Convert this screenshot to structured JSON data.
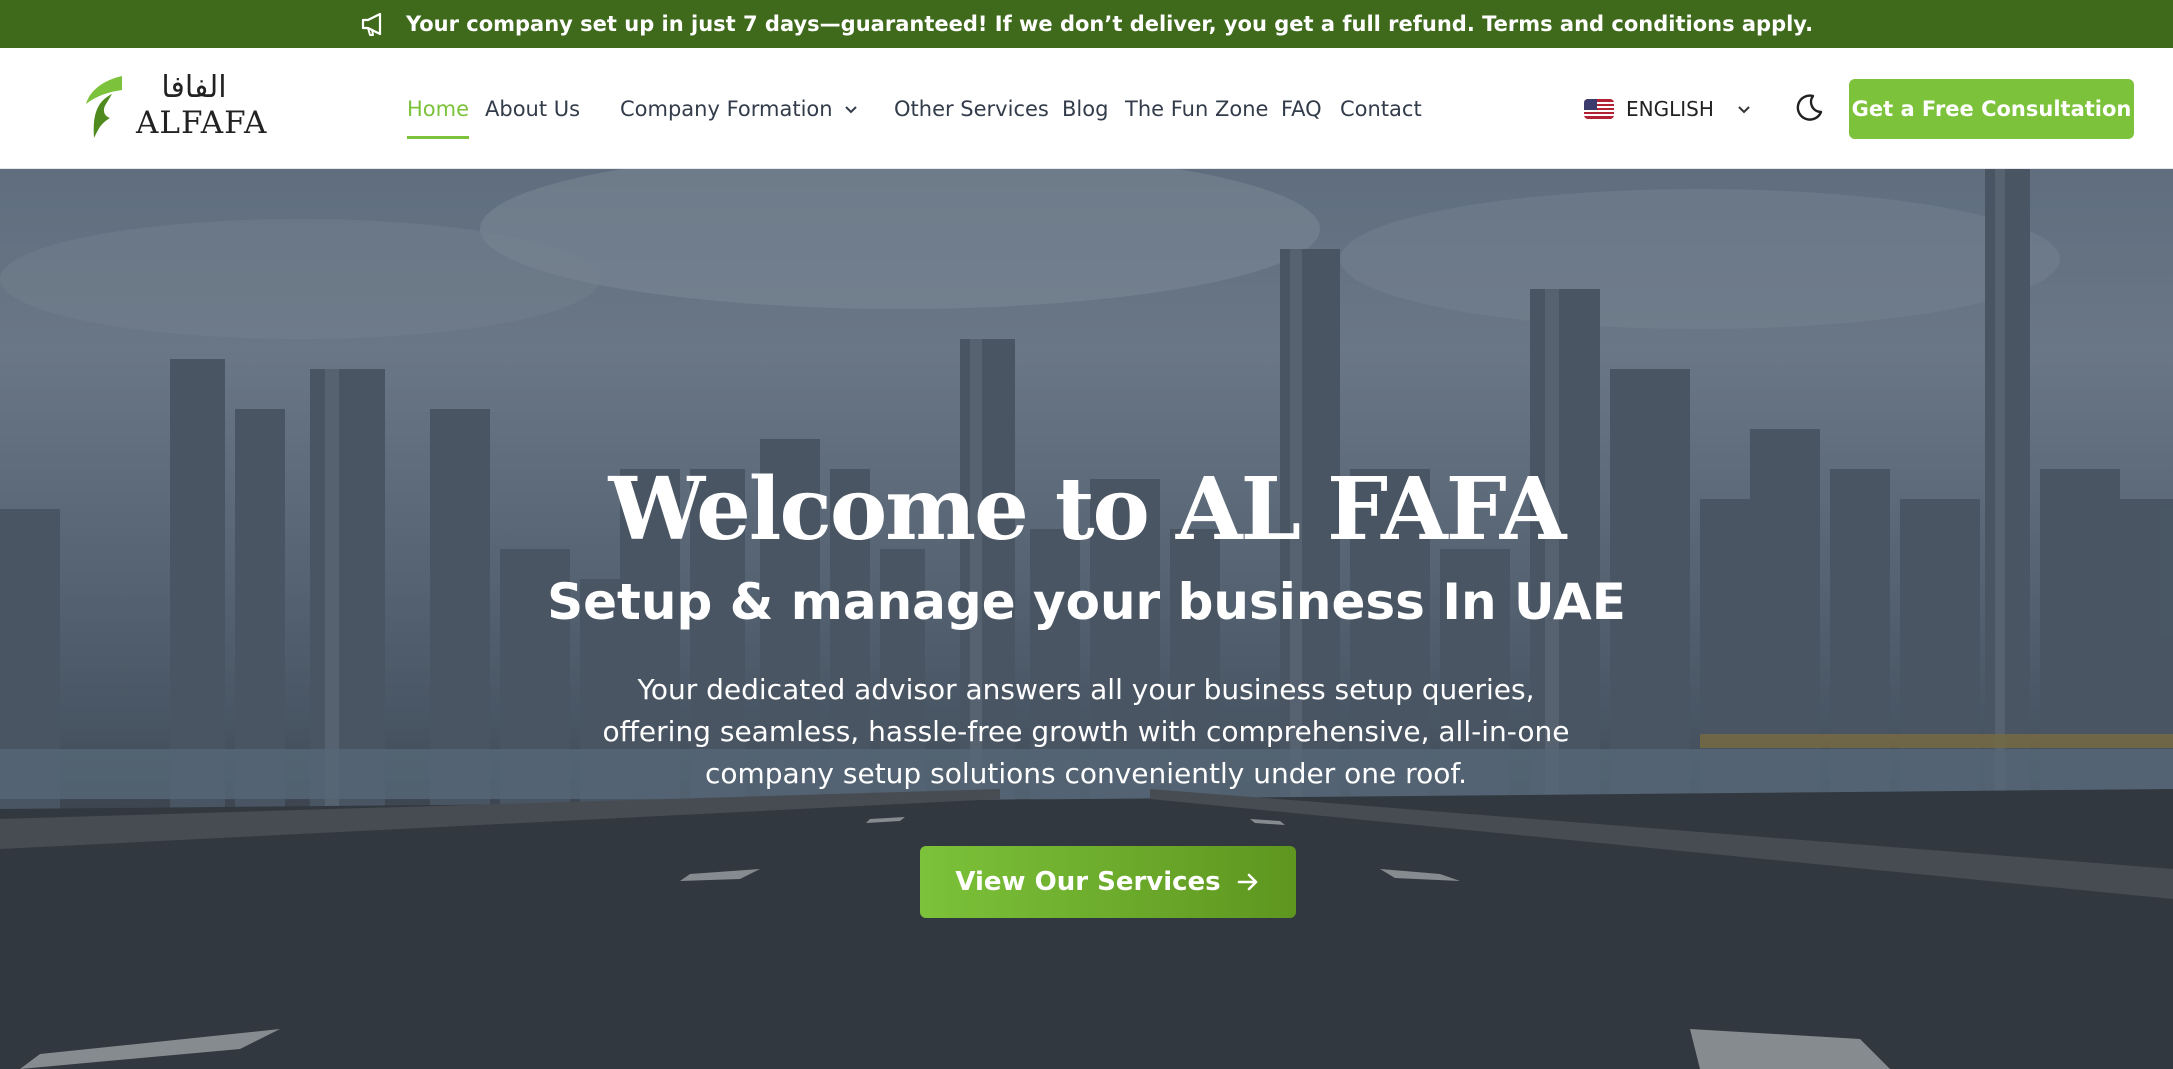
{
  "announcement": {
    "icon": "megaphone-icon",
    "text": "Your company set up in just 7 days—guaranteed! If we don’t deliver, you get a full refund. Terms and conditions apply."
  },
  "header": {
    "logo": {
      "arabic": "الفافا",
      "latin": "ALFAFA",
      "brand_color": "#7cc23a"
    },
    "nav": {
      "home": "Home",
      "about": "About Us",
      "company_formation": "Company Formation",
      "other_services": "Other Services",
      "blog": "Blog",
      "fun_zone": "The Fun Zone",
      "faq": "FAQ",
      "contact": "Contact"
    },
    "language": {
      "label": "ENGLISH",
      "flag": "us-flag-icon"
    },
    "theme_toggle": "moon-icon",
    "cta_label": "Get a Free Consultation"
  },
  "hero": {
    "title": "Welcome to AL FAFA",
    "subtitle": "Setup & manage your business In UAE",
    "description": "Your dedicated advisor answers all your business setup queries, offering seamless, hassle-free growth with comprehensive, all-in-one company setup solutions conveniently under one roof.",
    "button_label": "View Our Services",
    "button_icon": "arrow-right-icon"
  },
  "colors": {
    "announcement_bg": "#3f6a1c",
    "accent": "#7cc23a",
    "nav_text": "#333c4a"
  }
}
